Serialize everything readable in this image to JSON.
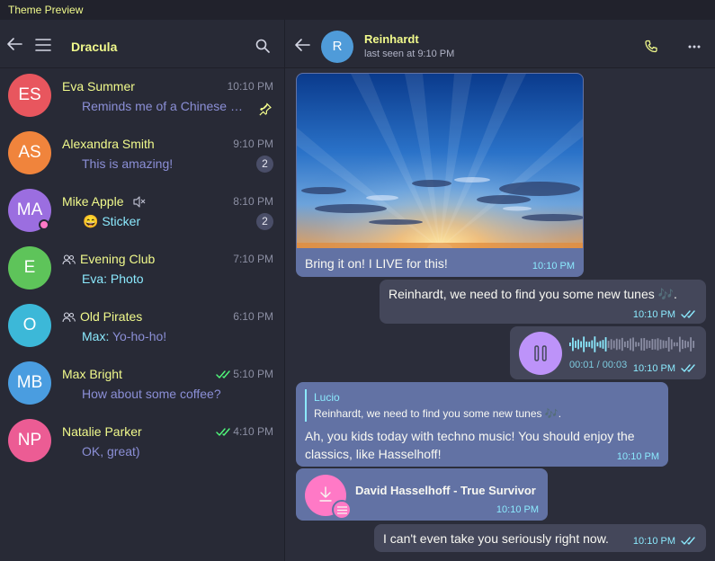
{
  "window": {
    "title": "Theme Preview"
  },
  "left_header": {
    "title": "Dracula"
  },
  "chats": [
    {
      "initials": "ES",
      "name": "Eva Summer",
      "time": "10:10 PM",
      "message": "Reminds me of a Chinese pr...",
      "pinned": true,
      "color": "#e8565e"
    },
    {
      "initials": "AS",
      "name": "Alexandra Smith",
      "time": "9:10 PM",
      "message": "This is amazing!",
      "unread": "2",
      "color": "#f0843c"
    },
    {
      "initials": "MA",
      "name": "Mike Apple",
      "time": "8:10 PM",
      "message": "Sticker",
      "sticker_emoji": "😄",
      "unread": "2",
      "muted": true,
      "color": "#9b6ee0"
    },
    {
      "initials": "E",
      "name": "Evening Club",
      "time": "7:10 PM",
      "sender": "Eva:",
      "message": "Photo",
      "group": true,
      "color": "#5ec45a"
    },
    {
      "initials": "O",
      "name": "Old Pirates",
      "time": "6:10 PM",
      "sender": "Max:",
      "message": "Yo-ho-ho!",
      "group": true,
      "color": "#3cb8d8"
    },
    {
      "initials": "MB",
      "name": "Max Bright",
      "time": "5:10 PM",
      "message": "How about some coffee?",
      "read": true,
      "color": "#4a9de0"
    },
    {
      "initials": "NP",
      "name": "Natalie Parker",
      "time": "4:10 PM",
      "message": "OK, great)",
      "read": true,
      "color": "#ec5c94"
    }
  ],
  "conversation": {
    "name": "Reinhardt",
    "initial": "R",
    "status": "last seen at 9:10 PM",
    "messages": {
      "photo_caption": "Bring it on! I LIVE for this!",
      "photo_time": "10:10 PM",
      "tunes_text": "Reinhardt, we need to find you some new tunes 🎶.",
      "tunes_time": "10:10 PM",
      "voice_duration": "00:01 / 00:03",
      "voice_time": "10:10 PM",
      "reply_author": "Lucio",
      "reply_quote": "Reinhardt, we need to find you some new tunes 🎶.",
      "reply_text": "Ah, you kids today with techno music! You should enjoy the classics, like Hasselhoff!",
      "reply_time": "10:10 PM",
      "song_title": "David Hasselhoff - True Survivor",
      "song_time": "10:10 PM",
      "last_text": "I can't even take you seriously right now.",
      "last_time": "10:10 PM"
    }
  },
  "colors": {
    "accent_yellow": "#f1fa8c",
    "accent_cyan": "#8be9fd",
    "pink": "#ff79c6",
    "purple": "#bd93f9",
    "check_green": "#50fa7b"
  }
}
